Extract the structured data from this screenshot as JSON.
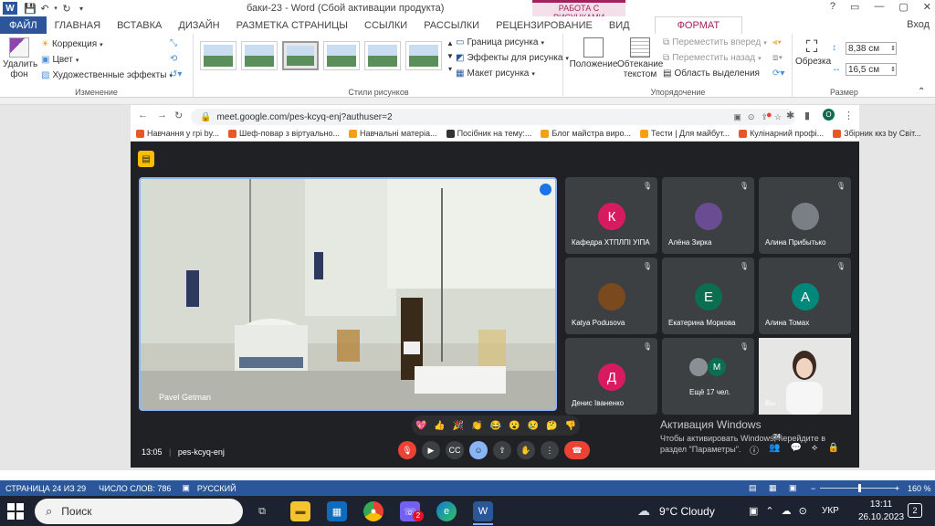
{
  "title_bar": {
    "title": "баки-23 - Word (Сбой активации продукта)",
    "context_tab": "РАБОТА С РИСУНКАМИ",
    "window_controls": [
      "?",
      "▭",
      "—",
      "▢",
      "✕"
    ],
    "login": "Вход"
  },
  "tabs": [
    "ФАЙЛ",
    "ГЛАВНАЯ",
    "ВСТАВКА",
    "ДИЗАЙН",
    "РАЗМЕТКА СТРАНИЦЫ",
    "ССЫЛКИ",
    "РАССЫЛКИ",
    "РЕЦЕНЗИРОВАНИЕ",
    "ВИД",
    "ФОРМАТ"
  ],
  "ribbon": {
    "remove_bg": "Удалить фон",
    "correction": "Коррекция",
    "color": "Цвет",
    "art_effects": "Художественные эффекты",
    "group_adjust": "Изменение",
    "group_styles": "Стили рисунков",
    "picture_border": "Граница рисунка",
    "picture_effects": "Эффекты для рисунка",
    "picture_layout": "Макет рисунка",
    "position": "Положение",
    "wrap_text": "Обтекание текстом",
    "bring_forward": "Переместить вперед",
    "send_backward": "Переместить назад",
    "selection_pane": "Область выделения",
    "group_arrange": "Упорядочение",
    "crop": "Обрезка",
    "height": "8,38 см",
    "width": "16,5 см",
    "group_size": "Размер"
  },
  "browser": {
    "url": "meet.google.com/pes-kcyq-enj?authuser=2",
    "profile": "O",
    "bookmarks": [
      {
        "label": "Навчання у грі by...",
        "color": "#e8572a"
      },
      {
        "label": "Шеф-повар з віртуально...",
        "color": "#e8572a"
      },
      {
        "label": "Навчальні матеріа...",
        "color": "#f4a015"
      },
      {
        "label": "Посібник на тему:...",
        "color": "#333333"
      },
      {
        "label": "Блог майстра виро...",
        "color": "#f4a015"
      },
      {
        "label": "Тести | Для майбут...",
        "color": "#f4a015"
      },
      {
        "label": "Кулінарний профі...",
        "color": "#e8572a"
      },
      {
        "label": "Збірник ккз by Світ...",
        "color": "#e8572a"
      }
    ]
  },
  "meet": {
    "presenter": "Pavel Getman",
    "participants": [
      {
        "name": "Кафедра ХТПЛПІ УІПА",
        "initial": "К",
        "color": "#d81b60"
      },
      {
        "name": "Алёна Зирка",
        "initial": "",
        "color": "#6a4c93"
      },
      {
        "name": "Алина Прибытько",
        "initial": "",
        "color": "#7a7f86"
      },
      {
        "name": "Katya Podusova",
        "initial": "",
        "color": "#7a4a1e"
      },
      {
        "name": "Екатерина Моркова",
        "initial": "Е",
        "color": "#0b6e4f"
      },
      {
        "name": "Алина Томах",
        "initial": "А",
        "color": "#00897b"
      },
      {
        "name": "Денис Іваненко",
        "initial": "Д",
        "color": "#d81b60"
      },
      {
        "name": "Ещё 17 чел.",
        "initial": "M",
        "color": "#0b6e4f"
      },
      {
        "name": "Вы",
        "initial": "",
        "color": "#c9c9c9"
      }
    ],
    "reactions": [
      "💖",
      "👍",
      "🎉",
      "👏",
      "😂",
      "😮",
      "😢",
      "🤔",
      "👎"
    ],
    "activation_title": "Активация Windows",
    "activation_text": "Чтобы активировать Windows, перейдите в раздел \"Параметры\".",
    "time": "13:05",
    "meeting_code": "pes-kcyq-enj",
    "participant_count": "24"
  },
  "status_bar": {
    "page": "СТРАНИЦА 24 ИЗ 29",
    "words": "ЧИСЛО СЛОВ: 786",
    "language": "РУССКИЙ",
    "zoom": "160 %"
  },
  "taskbar": {
    "search": "Поиск",
    "weather": "9°C  Cloudy",
    "language": "УКР",
    "time": "13:11",
    "date": "26.10.2023",
    "viber_badge": "2",
    "notifications": "2"
  }
}
